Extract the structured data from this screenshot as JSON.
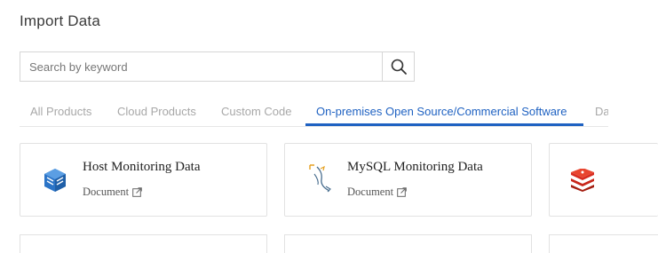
{
  "page": {
    "title": "Import Data"
  },
  "search": {
    "placeholder": "Search by keyword",
    "value": ""
  },
  "tabs": [
    {
      "label": "All Products"
    },
    {
      "label": "Cloud Products"
    },
    {
      "label": "Custom Code"
    },
    {
      "label": "On-premises Open Source/Commercial Software",
      "active": true
    },
    {
      "label": "Da"
    }
  ],
  "cards": [
    {
      "name": "Host Monitoring Data",
      "doc_label": "Document",
      "icon": "host-cube-icon",
      "highlighted": true
    },
    {
      "name": "MySQL Monitoring Data",
      "doc_label": "Document",
      "icon": "mysql-dolphin-icon"
    },
    {
      "name": "",
      "doc_label": "",
      "icon": "redis-stack-icon"
    }
  ],
  "colors": {
    "accent": "#1f62c2",
    "highlight": "#f6f41a",
    "host_icon": "#2b74c7",
    "redis_icon": "#d82c20"
  }
}
